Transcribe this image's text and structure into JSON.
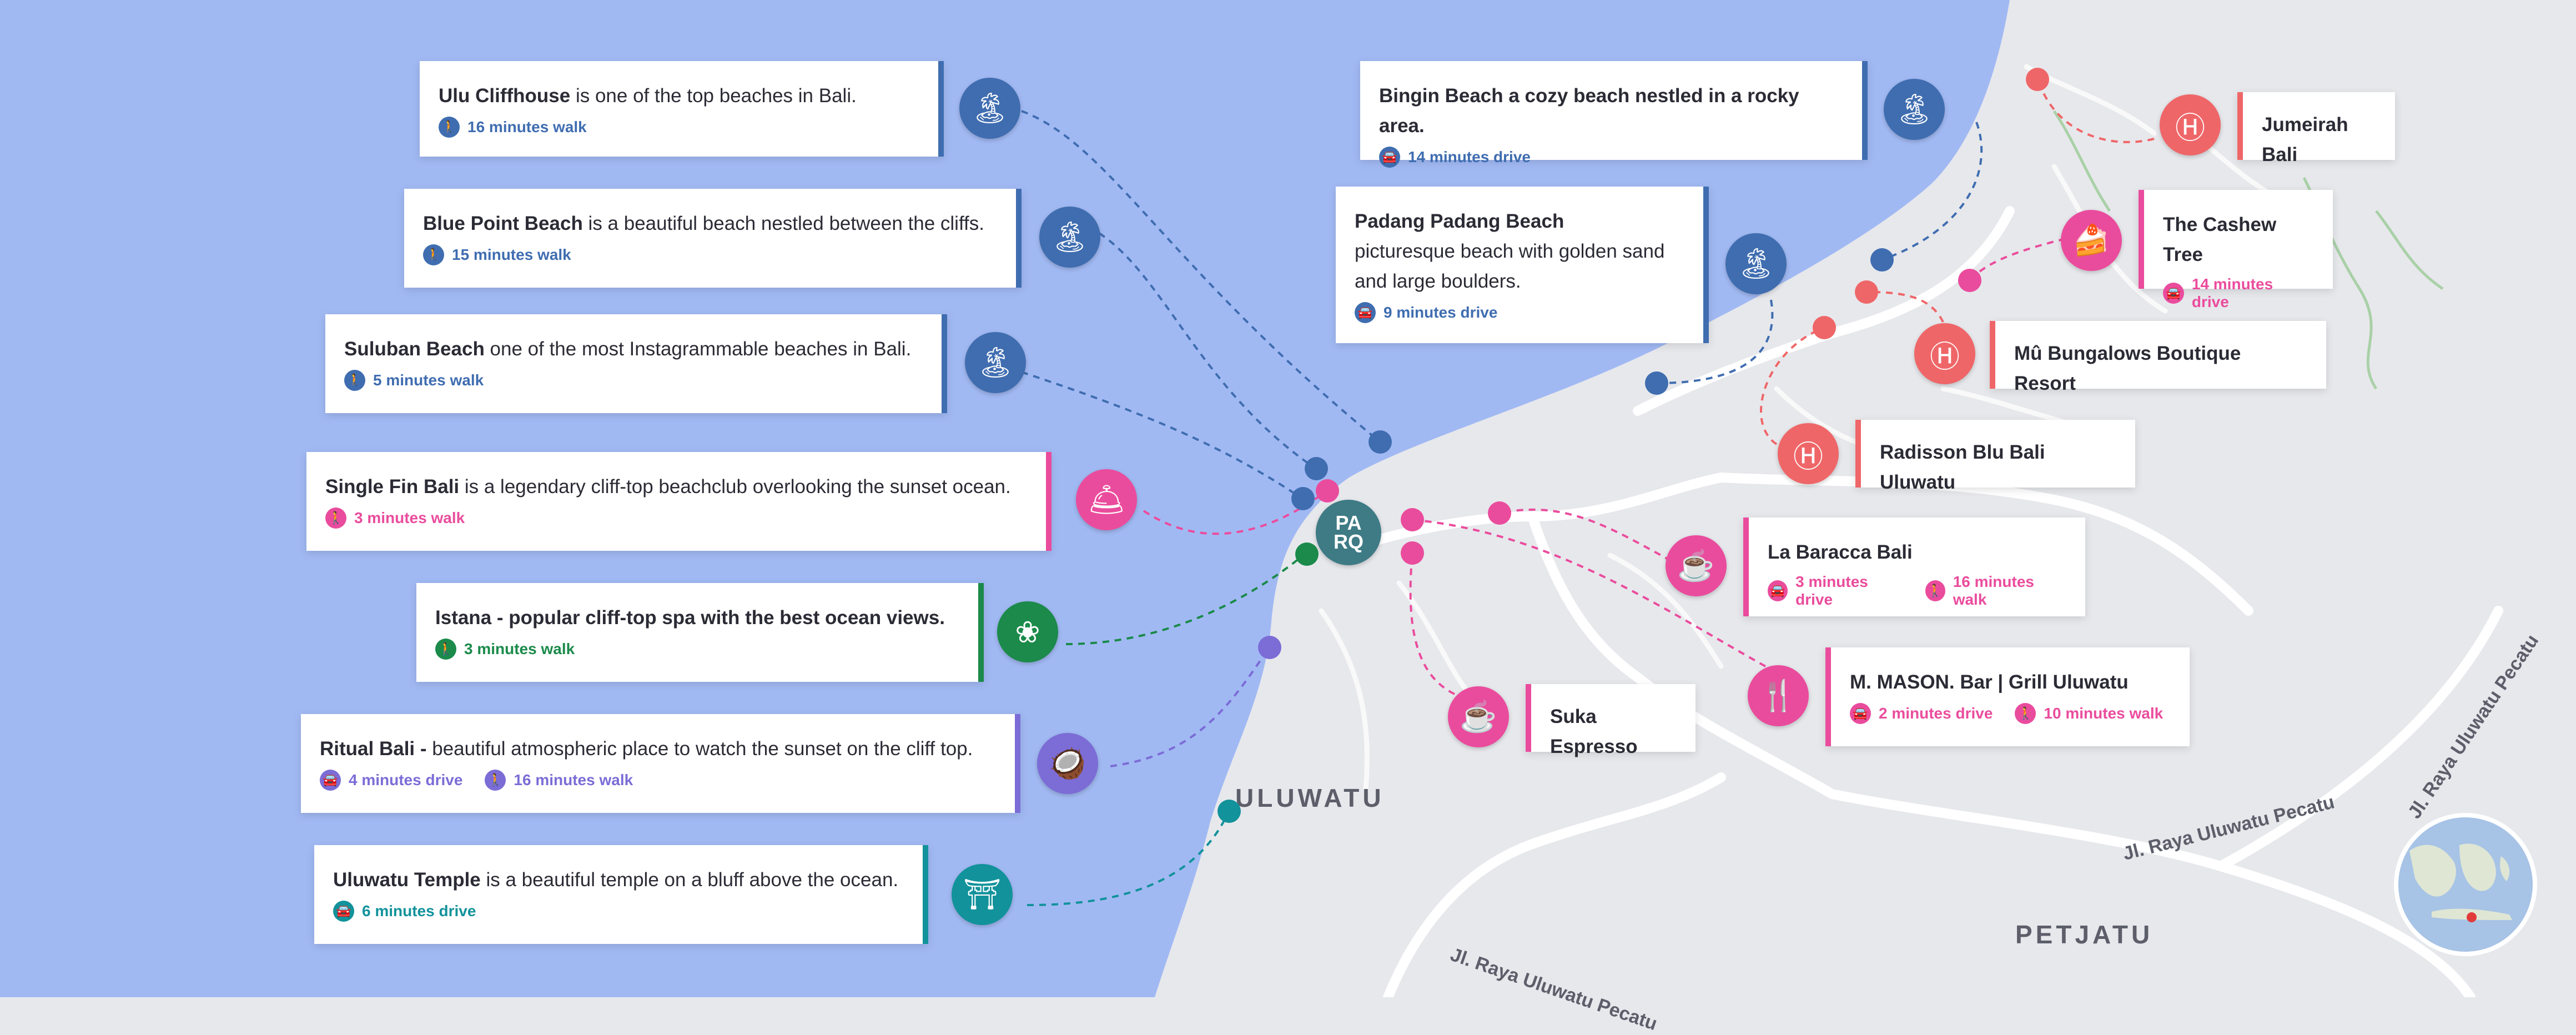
{
  "colors": {
    "ocean": "#a1b9f3",
    "land": "#e7e8ec",
    "blue": "#3f6db0",
    "pink": "#ea4c9d",
    "green": "#1b8a4a",
    "purple": "#7b6cd6",
    "teal": "#12929b",
    "red": "#ef6668",
    "parq": "#3e7b85"
  },
  "logo": {
    "line1": "PA",
    "line2": "RQ"
  },
  "map_labels": {
    "town1": "ULUWATU",
    "town2": "PETJATU",
    "road1": "Jl. Raya Uluwatu Pecatu",
    "road2": "Jl. Raya Uluwatu Pecatu",
    "road3": "Jl. Raya Uluwatu Pecatu"
  },
  "left_cards": [
    {
      "bold": "Ulu Cliffhouse",
      "text": " is one of the top beaches in Bali.",
      "travel": "16 minutes walk",
      "mode": "walk",
      "color": "#3f6db0",
      "icon": "beach-icon"
    },
    {
      "bold": "Blue Point Beach",
      "text": " is a beautiful beach nestled between the cliffs.",
      "travel": "15 minutes walk",
      "mode": "walk",
      "color": "#3f6db0",
      "icon": "beach-icon"
    },
    {
      "bold": "Suluban Beach",
      "text": " one of the most Instagrammable beaches in Bali.",
      "travel": "5 minutes walk",
      "mode": "walk",
      "color": "#3f6db0",
      "icon": "beach-icon"
    },
    {
      "bold": "Single Fin Bali",
      "text": " is a legendary cliff-top beachclub overlooking the sunset ocean.",
      "travel": "3 minutes walk",
      "mode": "walk",
      "color": "#ea4c9d",
      "icon": "cloche-icon"
    },
    {
      "bold": "Istana - popular cliff-top spa with the best ocean views.",
      "text": "",
      "travel": "3 minutes walk",
      "mode": "walk",
      "color": "#1b8a4a",
      "icon": "lotus-icon"
    },
    {
      "bold": "Ritual Bali -",
      "text": " beautiful atmospheric place to watch the sunset on the cliff top.",
      "travel": "4 minutes drive",
      "travel2": "16 minutes walk",
      "mode": "drive",
      "color": "#7b6cd6",
      "icon": "coconut-drink-icon"
    },
    {
      "bold": "Uluwatu Temple",
      "text": " is a beautiful temple on a bluff above the ocean.",
      "travel": "6 minutes drive",
      "mode": "drive",
      "color": "#12929b",
      "icon": "temple-icon"
    }
  ],
  "right_cards": [
    {
      "bold": "Bingin Beach a cozy beach nestled in a rocky area.",
      "text": "",
      "travel": "14 minutes drive",
      "color": "#3f6db0"
    },
    {
      "bold": "Padang Padang Beach",
      "text": " picturesque beach with golden sand and large boulders.",
      "travel": "9 minutes drive",
      "color": "#3f6db0"
    },
    {
      "bold": "Jumeirah Bali",
      "color": "#ef6668"
    },
    {
      "bold": "The Cashew Tree",
      "travel": "14 minutes drive",
      "color": "#ea4c9d"
    },
    {
      "bold": "Mû Bungalows Boutique Resort",
      "color": "#ef6668"
    },
    {
      "bold": "Radisson Blu Bali Uluwatu",
      "color": "#ef6668"
    },
    {
      "bold": "La Baracca Bali",
      "travel": "3 minutes drive",
      "travel2": "16 minutes walk",
      "color": "#ea4c9d"
    },
    {
      "bold": "M. MASON. Bar | Grill Uluwatu",
      "travel": "2 minutes drive",
      "travel2": "10 minutes walk",
      "color": "#ea4c9d"
    },
    {
      "bold": "Suka Espresso",
      "color": "#ea4c9d"
    }
  ]
}
